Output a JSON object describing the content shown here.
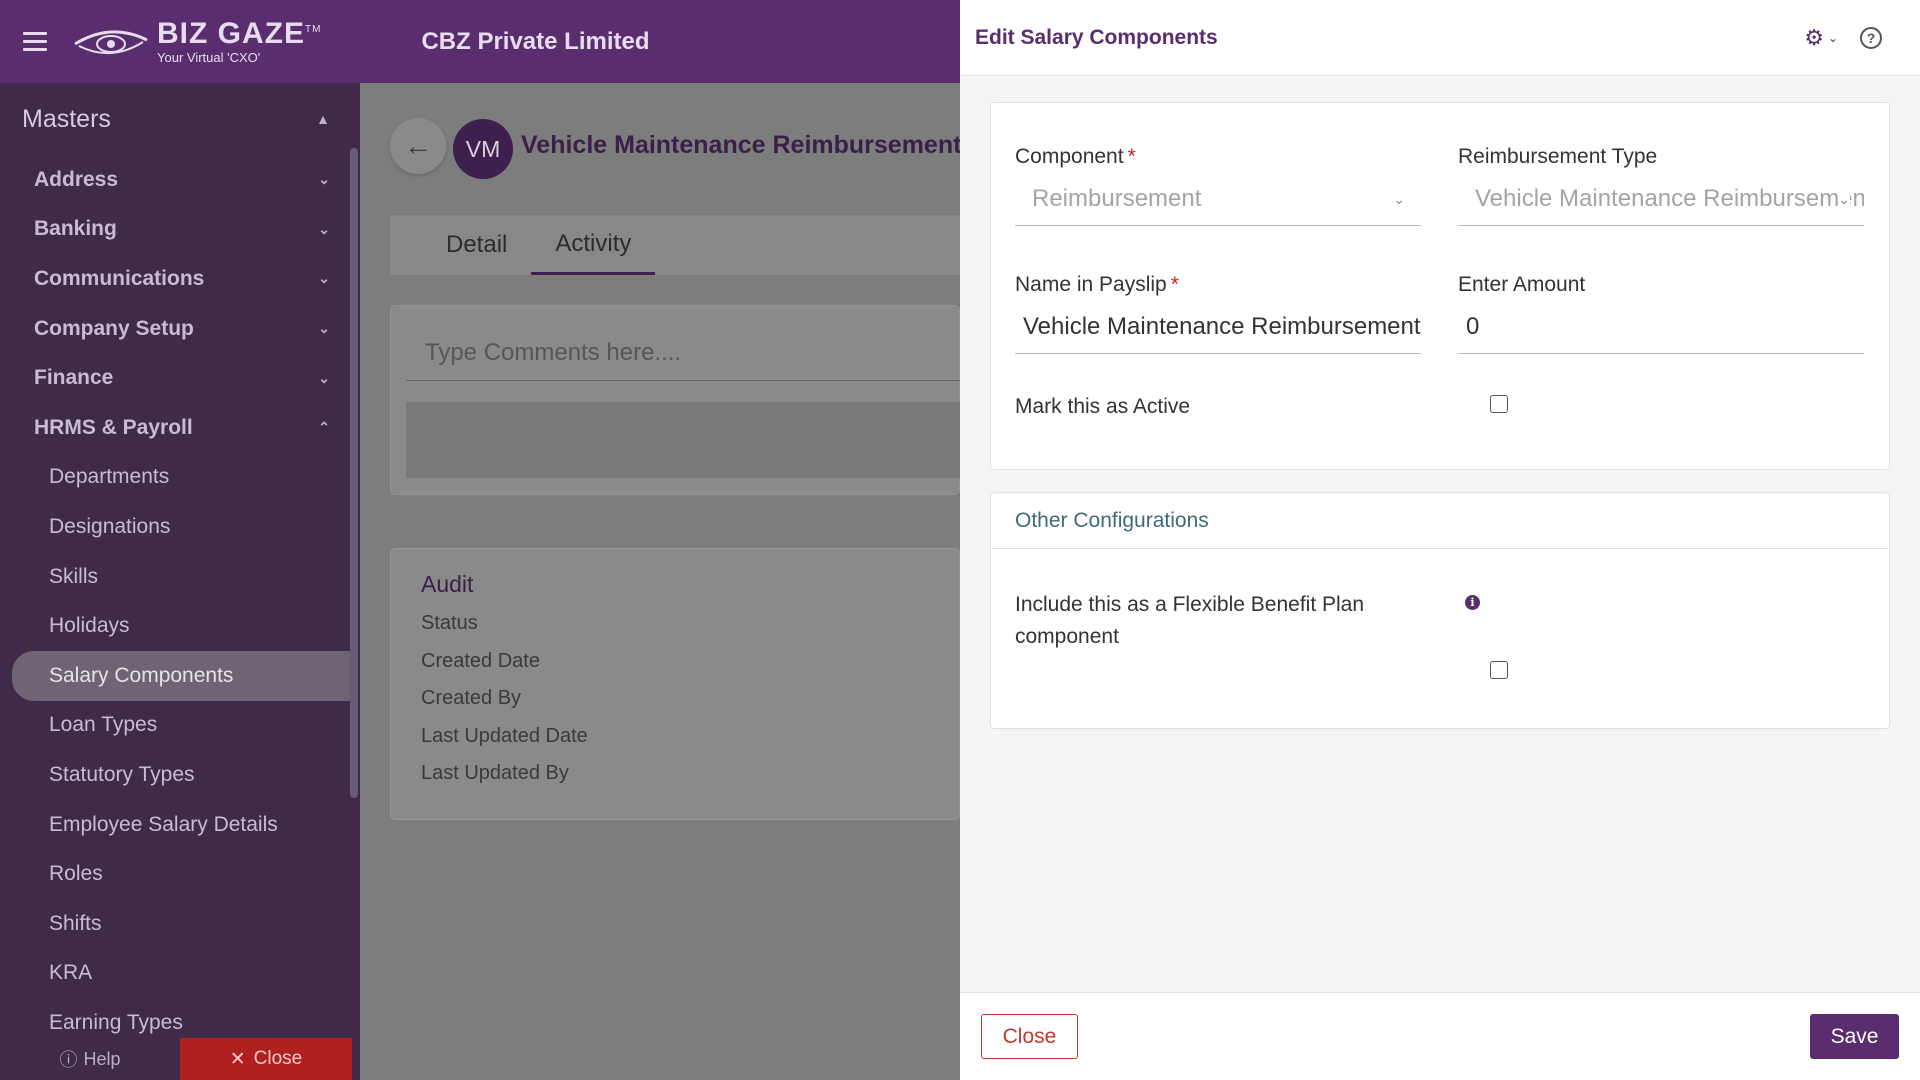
{
  "header": {
    "logo_name": "BIZ GAZE",
    "logo_tm": "TM",
    "logo_tagline": "Your Virtual 'CXO'",
    "company": "CBZ Private Limited"
  },
  "sidebar": {
    "heading": "Masters",
    "sections": [
      {
        "label": "Address"
      },
      {
        "label": "Banking"
      },
      {
        "label": "Communications"
      },
      {
        "label": "Company Setup"
      },
      {
        "label": "Finance"
      },
      {
        "label": "HRMS & Payroll"
      }
    ],
    "items": [
      {
        "label": "Departments"
      },
      {
        "label": "Designations"
      },
      {
        "label": "Skills"
      },
      {
        "label": "Holidays"
      },
      {
        "label": "Salary Components"
      },
      {
        "label": "Loan Types"
      },
      {
        "label": "Statutory Types"
      },
      {
        "label": "Employee Salary Details"
      },
      {
        "label": "Roles"
      },
      {
        "label": "Shifts"
      },
      {
        "label": "KRA"
      },
      {
        "label": "Earning Types"
      }
    ],
    "help_label": "Help",
    "close_label": "Close"
  },
  "record": {
    "avatar_initials": "VM",
    "title": "Vehicle Maintenance Reimbursement",
    "tabs": [
      {
        "label": "Detail"
      },
      {
        "label": "Activity"
      }
    ],
    "comment_placeholder": "Type Comments here....",
    "audit": {
      "title": "Audit",
      "rows": [
        "Status",
        "Created Date",
        "Created By",
        "Last Updated Date",
        "Last Updated By"
      ]
    }
  },
  "panel": {
    "title": "Edit Salary Components",
    "component_label": "Component",
    "component_value": "Reimbursement",
    "reimb_type_label": "Reimbursement Type",
    "reimb_type_value": "Vehicle Maintenance Reimbursement",
    "payslip_label": "Name in Payslip",
    "payslip_value": "Vehicle Maintenance Reimbursement",
    "amount_label": "Enter Amount",
    "amount_value": "0",
    "active_label": "Mark this as Active",
    "other_config_title": "Other Configurations",
    "fbp_label": "Include this as a Flexible Benefit Plan component",
    "close_label": "Close",
    "save_label": "Save"
  }
}
